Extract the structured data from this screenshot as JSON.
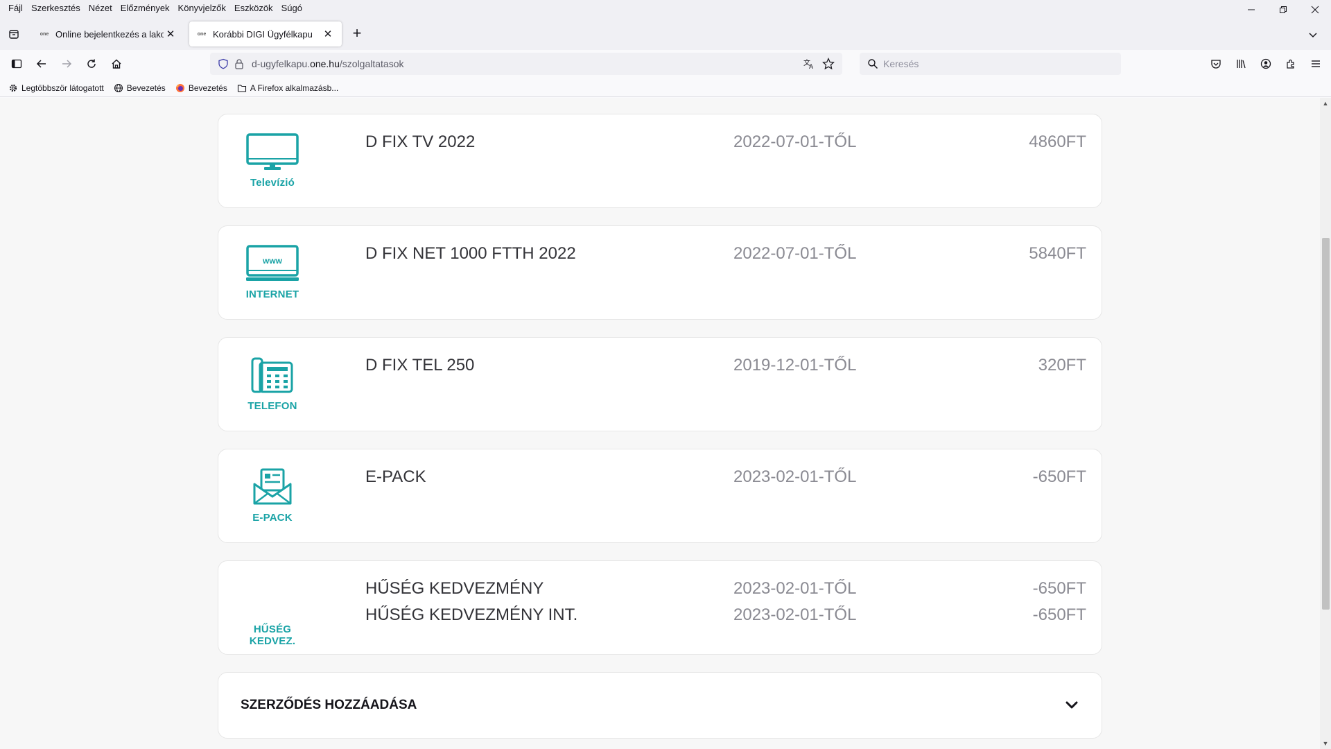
{
  "menubar": {
    "items": [
      "Fájl",
      "Szerkesztés",
      "Nézet",
      "Előzmények",
      "Könyvjelzők",
      "Eszközök",
      "Súgó"
    ]
  },
  "tabs": [
    {
      "title": "Online bejelentkezés a lakosság",
      "favicon": "one"
    },
    {
      "title": "Korábbi DIGI Ügyfélkapu",
      "favicon": "one"
    }
  ],
  "urlbar": {
    "prefix": "d-ugyfelkapu.",
    "host": "one.hu",
    "path": "/szolgaltatasok"
  },
  "searchbar": {
    "placeholder": "Keresés"
  },
  "bookmarks": [
    {
      "label": "Legtöbbször látogatott",
      "icon": "gear-icon"
    },
    {
      "label": "Bevezetés",
      "icon": "globe-icon"
    },
    {
      "label": "Bevezetés",
      "icon": "firefox-icon"
    },
    {
      "label": "A Firefox alkalmazásb...",
      "icon": "folder-icon"
    }
  ],
  "services": [
    {
      "category": "Televízió",
      "icon": "tv-icon",
      "rows": [
        {
          "name": "D FIX TV 2022",
          "date": "2022-07-01-TŐL",
          "price": "4860FT"
        }
      ]
    },
    {
      "category": "INTERNET",
      "icon": "www-monitor-icon",
      "icon_text": "www",
      "rows": [
        {
          "name": "D FIX NET 1000 FTTH 2022",
          "date": "2022-07-01-TŐL",
          "price": "5840FT"
        }
      ]
    },
    {
      "category": "TELEFON",
      "icon": "desk-phone-icon",
      "rows": [
        {
          "name": "D FIX TEL 250",
          "date": "2019-12-01-TŐL",
          "price": "320FT"
        }
      ]
    },
    {
      "category": "E-PACK",
      "icon": "envelope-letter-icon",
      "rows": [
        {
          "name": "E-PACK",
          "date": "2023-02-01-TŐL",
          "price": "-650FT"
        }
      ]
    },
    {
      "category": "HŰSÉG KEDVEZ.",
      "icon": "",
      "rows": [
        {
          "name": "HŰSÉG KEDVEZMÉNY",
          "date": "2023-02-01-TŐL",
          "price": "-650FT"
        },
        {
          "name": "HŰSÉG KEDVEZMÉNY INT.",
          "date": "2023-02-01-TŐL",
          "price": "-650FT"
        }
      ]
    }
  ],
  "add_contract": {
    "label": "SZERZŐDÉS HOZZÁADÁSA"
  },
  "colors": {
    "accent": "#1aa3a6",
    "text_dark": "#333338",
    "text_muted": "#8a8a92"
  }
}
